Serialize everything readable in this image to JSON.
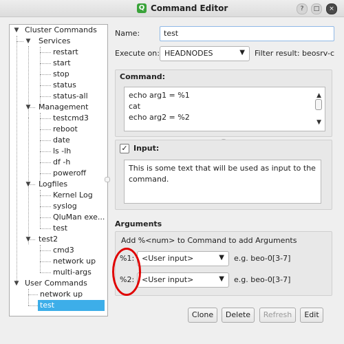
{
  "window": {
    "title": "Command Editor",
    "app_icon": "Q",
    "controls": {
      "help": "?",
      "maximize": "□",
      "close": "×"
    }
  },
  "tree": {
    "root1": "Cluster Commands",
    "services": "Services",
    "services_items": [
      "restart",
      "start",
      "stop",
      "status",
      "status-all"
    ],
    "management": "Management",
    "management_items": [
      "testcmd3",
      "reboot",
      "date",
      "ls -lh",
      "df -h",
      "poweroff"
    ],
    "logfiles": "Logfiles",
    "logfiles_items": [
      "Kernel Log",
      "syslog",
      "QluMan exe...",
      "test"
    ],
    "test2": "test2",
    "test2_items": [
      "cmd3",
      "network up",
      "multi-args"
    ],
    "root2": "User Commands",
    "user_items": [
      "network up",
      "test"
    ],
    "expanded_glyph": "▼",
    "selected": "test"
  },
  "form": {
    "name_label": "Name:",
    "name_value": "test",
    "execute_label": "Execute on:",
    "execute_value": "HEADNODES",
    "filter_result": "Filter result: beosrv-c",
    "command_label": "Command:",
    "command_lines": [
      "echo arg1 = %1",
      "cat",
      "echo arg2 = %2"
    ],
    "input_checked": true,
    "input_label": "Input:",
    "input_text": "This is some text that will be used as input to the command.",
    "arguments_label": "Arguments",
    "arguments_hint": "Add %<num> to Command to add Arguments",
    "arguments": [
      {
        "tag": "%1:",
        "value": "<User input>",
        "example": "e.g. beo-0[3-7]"
      },
      {
        "tag": "%2:",
        "value": "<User input>",
        "example": "e.g. beo-0[3-7]"
      }
    ]
  },
  "buttons": {
    "clone": "Clone",
    "delete": "Delete",
    "refresh": "Refresh",
    "edit": "Edit"
  },
  "colors": {
    "selection": "#3daee9",
    "annotation": "#e00000",
    "accent_border": "#8fb8e6"
  }
}
